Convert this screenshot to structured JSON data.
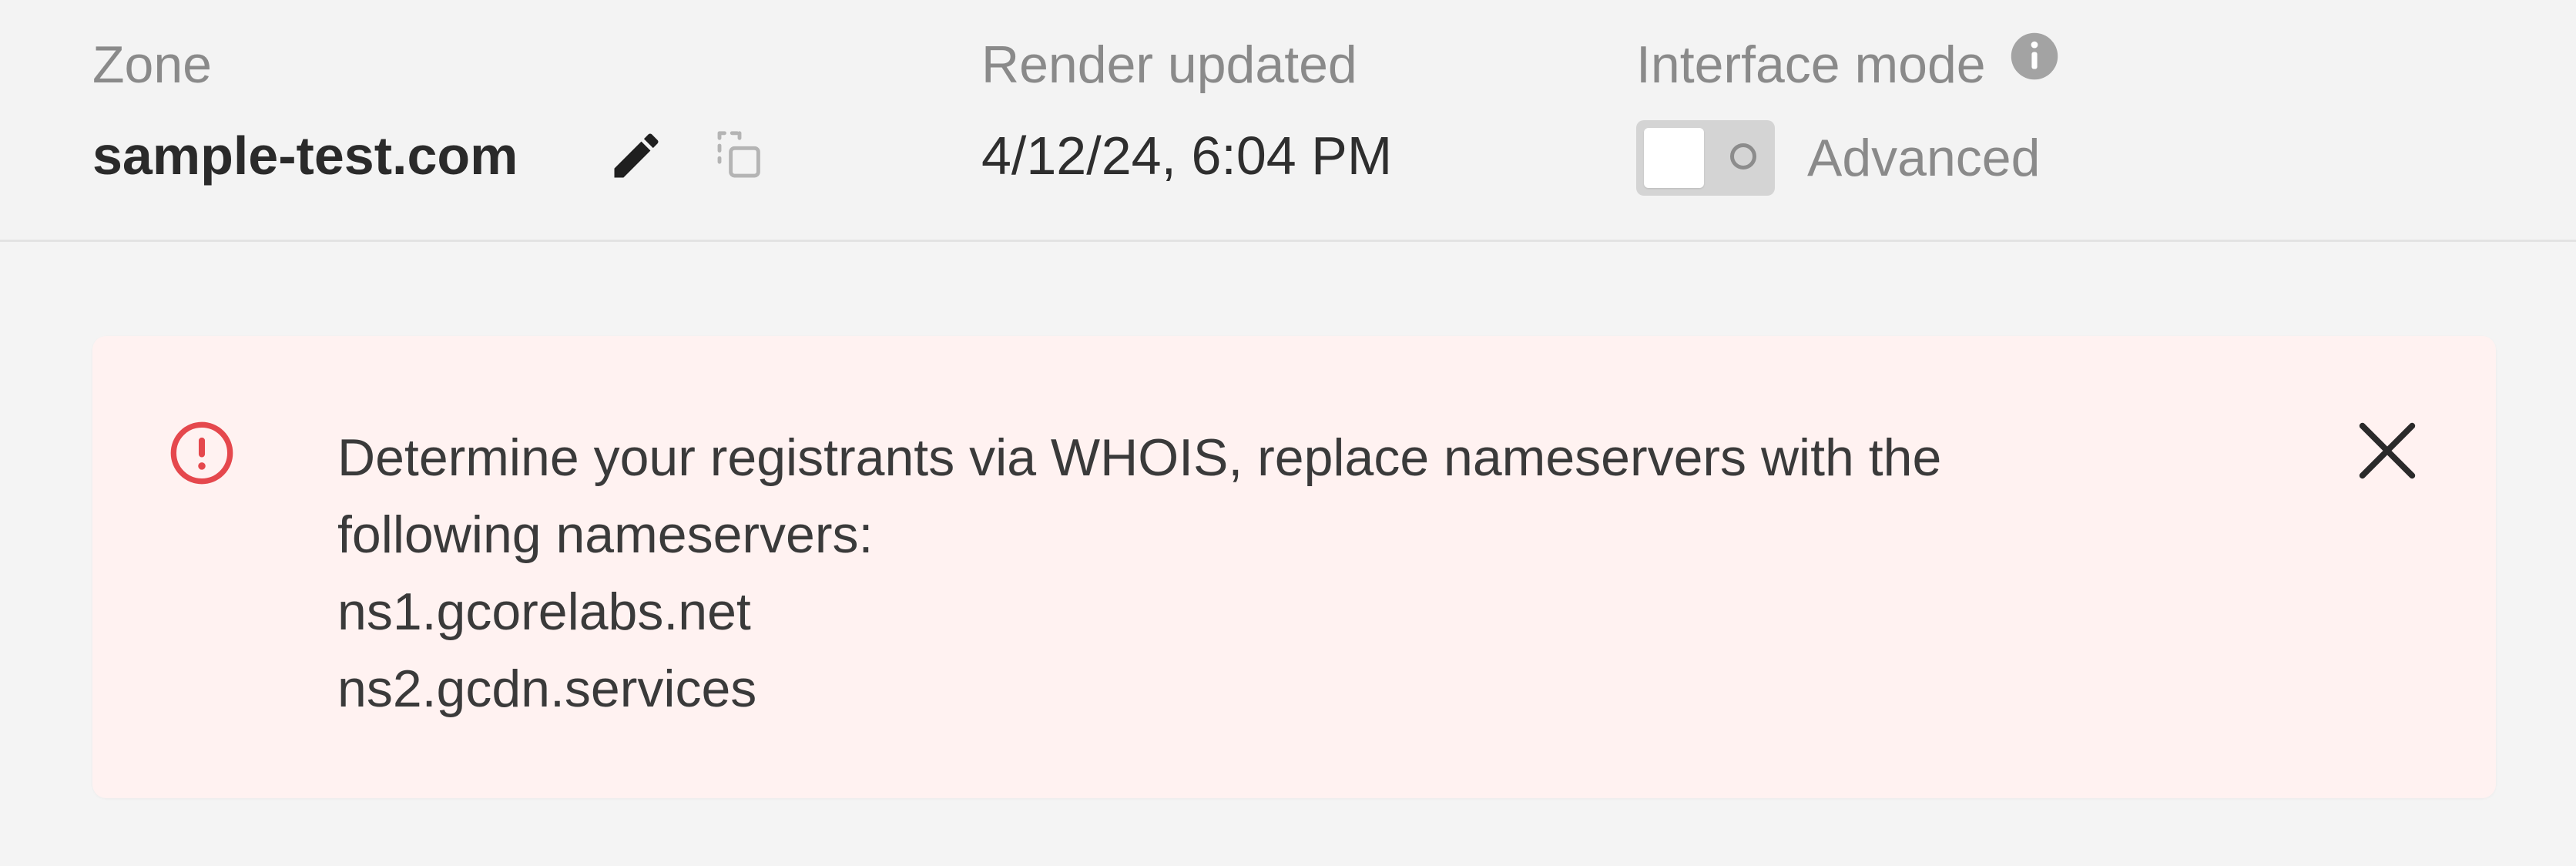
{
  "header": {
    "zone": {
      "label": "Zone",
      "value": "sample-test.com",
      "edit_icon": "pencil-icon",
      "copy_icon": "copy-icon"
    },
    "render": {
      "label": "Render updated",
      "value": "4/12/24, 6:04 PM"
    },
    "interface_mode": {
      "label": "Interface mode",
      "info_icon": "info-icon",
      "toggle_state": "off",
      "toggle_label": "Advanced"
    }
  },
  "alert": {
    "type": "error",
    "icon": "exclamation-circle-icon",
    "accent_color": "#e5484d",
    "lines": [
      "Determine your registrants via WHOIS, replace nameservers with the",
      "following nameservers:",
      "ns1.gcorelabs.net",
      "ns2.gcdn.services"
    ],
    "close_icon": "close-icon"
  },
  "colors": {
    "page_background": "#f4f4f4",
    "alert_background": "#fff2f1",
    "muted_text": "#8a8a8a",
    "text": "#2e2e2e"
  }
}
